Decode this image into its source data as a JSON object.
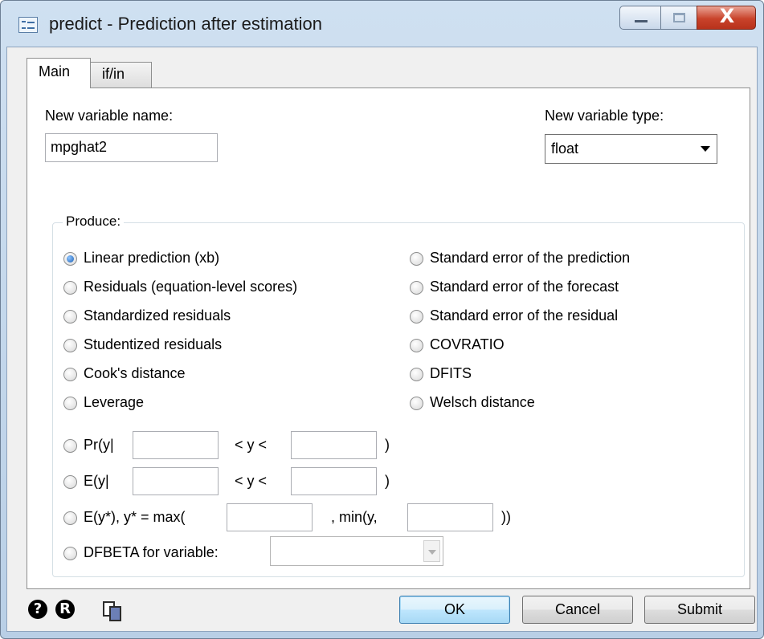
{
  "window": {
    "title": "predict - Prediction after estimation",
    "close_glyph": "X"
  },
  "tabs": [
    {
      "label": "Main",
      "active": true
    },
    {
      "label": "if/in",
      "active": false
    }
  ],
  "new_var": {
    "label": "New variable name:",
    "value": "mpghat2"
  },
  "var_type": {
    "label": "New variable type:",
    "value": "float"
  },
  "produce": {
    "title": "Produce:",
    "left": [
      {
        "label": "Linear prediction (xb)",
        "checked": true
      },
      {
        "label": "Residuals (equation-level scores)",
        "checked": false
      },
      {
        "label": "Standardized residuals",
        "checked": false
      },
      {
        "label": "Studentized residuals",
        "checked": false
      },
      {
        "label": "Cook's distance",
        "checked": false
      },
      {
        "label": "Leverage",
        "checked": false
      }
    ],
    "right": [
      {
        "label": "Standard error of the prediction",
        "checked": false
      },
      {
        "label": "Standard error of the forecast",
        "checked": false
      },
      {
        "label": "Standard error of the residual",
        "checked": false
      },
      {
        "label": "COVRATIO",
        "checked": false
      },
      {
        "label": "DFITS",
        "checked": false
      },
      {
        "label": "Welsch distance",
        "checked": false
      }
    ],
    "pr": {
      "label": "Pr(y|",
      "mid": "< y <",
      "end": ")",
      "low": "",
      "high": ""
    },
    "ey": {
      "label": "E(y|",
      "mid": "< y <",
      "end": ")",
      "low": "",
      "high": ""
    },
    "ystar": {
      "label": "E(y*), y* = max(",
      "mid": ", min(y,",
      "end": "))",
      "low": "",
      "high": ""
    },
    "dfbeta": {
      "label": "DFBETA for variable:",
      "value": ""
    }
  },
  "footer": {
    "ok": "OK",
    "cancel": "Cancel",
    "submit": "Submit",
    "help_glyph": "?",
    "reset_glyph": "R"
  },
  "icons": [
    "dialog-icon",
    "minimize-icon",
    "maximize-icon",
    "close-icon",
    "help-icon",
    "reset-icon",
    "copy-command-icon",
    "dropdown-arrow-icon"
  ]
}
